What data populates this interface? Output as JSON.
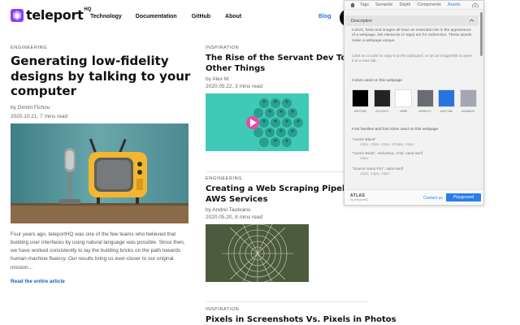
{
  "header": {
    "logo_text": "teleport",
    "logo_sup": "HQ",
    "nav": [
      "Technology",
      "Documentation",
      "GitHub",
      "About"
    ],
    "blog": "Blog"
  },
  "articles": {
    "featured": {
      "category": "ENGINEERING",
      "title": "Generating low-fidelity designs by talking to your computer",
      "author": "by Dimitri Fichou",
      "date": "2020.10.21, 7 mins read",
      "excerpt": "Four years ago, teleportHQ was one of the few teams who believed that building user interfaces by using natural language was possible. Since then, we have worked consistently to lay the building bricks on the path towards human-machine fluency. Our results bring us ever-closer to our original mission...",
      "read_more": "Read the entire article"
    },
    "second": {
      "category": "INSPIRATION",
      "title_line1": "The Rise of the Servant Dev Tools",
      "title_line2": "Other Things",
      "author": "by Alex M.",
      "date": "2020.05.22, 3 mins read"
    },
    "third": {
      "category": "ENGINEERING",
      "title_line1": "Creating a Web Scraping Pipeline",
      "title_line2": "AWS Services",
      "author": "by Andrei Tauteanu",
      "date": "2020.05.20, 8 mins read"
    },
    "fourth": {
      "category": "INSPIRATION",
      "title": "Pixels in Screenshots Vs. Pixels in Photos"
    }
  },
  "popup": {
    "tabs": [
      "Tags",
      "Semantic",
      "Depth",
      "Components",
      "Assets"
    ],
    "active_tab": "Assets",
    "section_title": "Description",
    "description": "Colors, fonts and images all have an essential role in the appearance of a webpage, link elements (A tags) are for redirection. These assets make a webpage unique.",
    "hint": "Click on a color to copy it to the clipboard, or on an image/link to open it in a new tab.",
    "colors_label": "Colors used on this webpage",
    "colors": [
      {
        "hex": "#000000",
        "label": "#000000"
      },
      {
        "hex": "#222323",
        "label": "#222323"
      },
      {
        "hex": "#ffffff",
        "label": "#ffffff"
      },
      {
        "hex": "#696c70",
        "label": "#696c70"
      },
      {
        "hex": "#2874de",
        "label": "#2874de"
      },
      {
        "hex": "#a5a6b5",
        "label": "#a5a6b5"
      }
    ],
    "fonts_label": "Font families and font sizes used on this webpage",
    "fonts": [
      {
        "name": "\"Avenir Black\"",
        "sizes": "14px, 15px, 22px, 25.6px, 16px"
      },
      {
        "name": "\"Avenir Book\", Helvetica, Arial, sans-serif",
        "sizes": "16px"
      },
      {
        "name": "\"Source Sans Pro\", sans-serif",
        "sizes": "12px, 14px, 16px"
      }
    ],
    "footer": {
      "brand": "ATLAS",
      "brand_sub": "by teleportHQ",
      "contact": "Contact us",
      "playground": "Playground"
    }
  }
}
